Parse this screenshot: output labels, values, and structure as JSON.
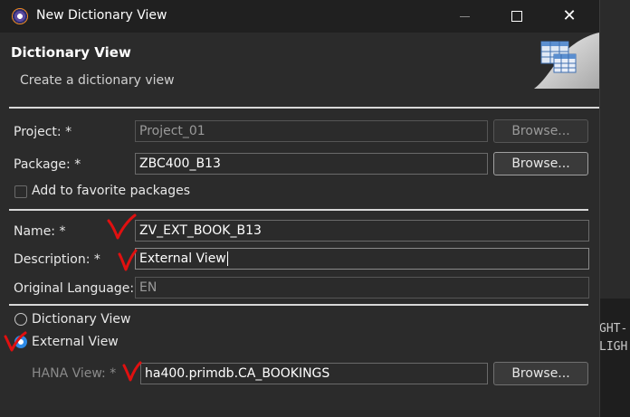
{
  "window": {
    "title": "New Dictionary View"
  },
  "header": {
    "title": "Dictionary View",
    "description": "Create a dictionary view"
  },
  "project": {
    "label": "Project: *",
    "value": "Project_01",
    "browse_label": "Browse..."
  },
  "package": {
    "label": "Package: *",
    "value": "ZBC400_B13",
    "browse_label": "Browse..."
  },
  "favorites": {
    "label": "Add to favorite packages",
    "checked": false
  },
  "name": {
    "label": "Name: *",
    "value": "ZV_EXT_BOOK_B13"
  },
  "description": {
    "label": "Description: *",
    "value": "External View"
  },
  "original_language": {
    "label": "Original Language:",
    "value": "EN"
  },
  "view_type": {
    "options": [
      {
        "label": "Dictionary View",
        "selected": false
      },
      {
        "label": "External View",
        "selected": true
      }
    ]
  },
  "hana_view": {
    "label": "HANA View: *",
    "value": "ha400.primdb.CA_BOOKINGS",
    "browse_label": "Browse..."
  },
  "background": {
    "right_lines": [
      "GHT-",
      "LIGH"
    ]
  },
  "colors": {
    "dialog_bg": "#2b2b2b",
    "titlebar_bg": "#202020",
    "radio_accent": "#2e8be6",
    "annotation_red": "#e01010"
  }
}
